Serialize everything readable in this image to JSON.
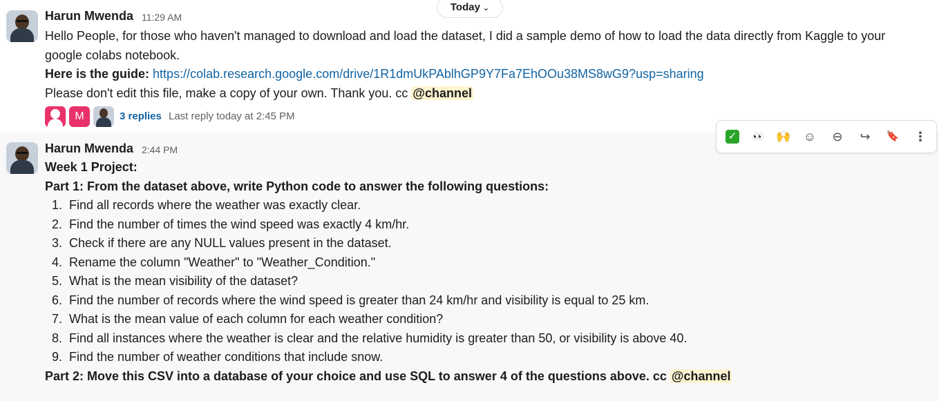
{
  "divider": {
    "label": "Today",
    "chevron_icon": "chevron-down-icon"
  },
  "message1": {
    "sender": "Harun Mwenda",
    "time": "11:29 AM",
    "line1": "Hello People, for those who haven't managed to download and load the dataset, I did a sample demo of how to load the data directly from Kaggle to your",
    "line2": "google colabs notebook.",
    "guide_label": "Here is the guide:",
    "guide_url": "https://colab.research.google.com/drive/1R1dmUkPAblhGP9Y7Fa7EhOOu38MS8wG9?usp=sharing",
    "line4": "Please don't edit this file, make a copy of your own. Thank you. cc",
    "mention": "@channel",
    "reply_avatar_initial": "M",
    "replies_count": "3 replies",
    "last_reply": "Last reply today at 2:45 PM"
  },
  "toolbar": {
    "icons": [
      "check-reaction-icon",
      "eyes-reaction-icon",
      "raised-hands-reaction-icon",
      "add-reaction-icon",
      "reply-in-thread-icon",
      "share-icon",
      "bookmark-icon",
      "more-actions-icon"
    ],
    "check": "✓",
    "eyes": "👀",
    "hands": "🙌",
    "emoji": "☺",
    "thread": "⊖",
    "share": "↪",
    "bookmark": "🔖",
    "more": "⋮"
  },
  "message2": {
    "sender": "Harun Mwenda",
    "time": "2:44 PM",
    "title": "Week 1 Project:",
    "part1": "Part 1: From the dataset above, write Python code to answer the following questions:",
    "items": [
      "Find all records where the weather was exactly clear.",
      "Find the number of times the wind speed was exactly 4 km/hr.",
      "Check if there are any NULL values present in the dataset.",
      "Rename the column \"Weather\" to \"Weather_Condition.\"",
      "What is the mean visibility of the dataset?",
      "Find the number of records where the wind speed is greater than 24 km/hr and visibility is equal to 25 km.",
      "What is the mean value of each column for each weather condition?",
      "Find all instances where the weather is clear and the relative humidity is greater than 50, or visibility is above 40.",
      "Find the number of weather conditions that include snow."
    ],
    "part2": "Part 2: Move this CSV into a database of your choice and use SQL to answer 4 of the questions above. cc",
    "mention": "@channel"
  }
}
